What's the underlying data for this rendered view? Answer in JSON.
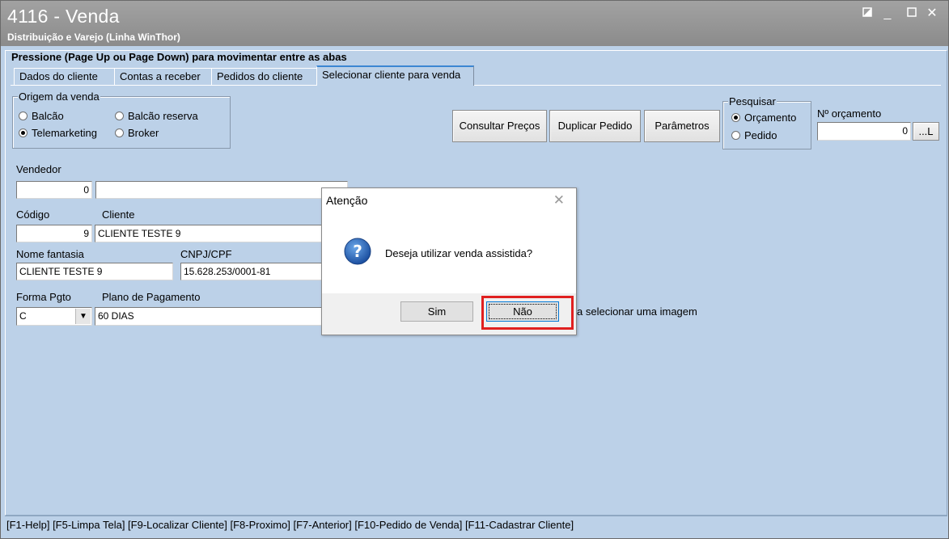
{
  "window": {
    "title": "4116 - Venda",
    "subtitle": "Distribuição e Varejo (Linha WinThor)",
    "controls": [
      "restore-icon",
      "minimize-icon",
      "maximize-icon",
      "close-icon"
    ]
  },
  "tabs_hint": "Pressione (Page Up ou Page Down) para movimentar entre as abas",
  "tabs": [
    {
      "label": "Dados do cliente",
      "active": false
    },
    {
      "label": "Contas a receber",
      "active": false
    },
    {
      "label": "Pedidos do cliente",
      "active": false
    },
    {
      "label": "Selecionar cliente para venda",
      "active": true
    }
  ],
  "origem": {
    "label": "Origem da venda",
    "options": [
      {
        "label": "Balcão",
        "checked": false
      },
      {
        "label": "Balcão reserva",
        "checked": false
      },
      {
        "label": "Telemarketing",
        "checked": true
      },
      {
        "label": "Broker",
        "checked": false
      }
    ]
  },
  "toolbar": {
    "consultar_precos": "Consultar Preços",
    "duplicar_pedido": "Duplicar Pedido",
    "parametros": "Parâmetros"
  },
  "pesquisar": {
    "label": "Pesquisar",
    "options": [
      {
        "label": "Orçamento",
        "checked": true
      },
      {
        "label": "Pedido",
        "checked": false
      }
    ]
  },
  "orcamento": {
    "label": "Nº orçamento",
    "value": "0",
    "lookup_label": "...L"
  },
  "form": {
    "vendedor_label": "Vendedor",
    "vendedor_code": "0",
    "vendedor_name": "",
    "codigo_label": "Código",
    "cliente_label": "Cliente",
    "codigo_value": "9",
    "cliente_value": "CLIENTE TESTE 9",
    "nome_fantasia_label": "Nome fantasia",
    "nome_fantasia_value": "CLIENTE TESTE 9",
    "cnpj_label": "CNPJ/CPF",
    "cnpj_value": "15.628.253/0001-81",
    "forma_pgto_label": "Forma Pgto",
    "forma_pgto_value": "C",
    "plano_label": "Plano de Pagamento",
    "plano_value": "60 DIAS",
    "image_hint": "a selecionar uma imagem"
  },
  "statusbar": "[F1-Help] [F5-Limpa Tela] [F9-Localizar Cliente] [F8-Proximo] [F7-Anterior] [F10-Pedido de Venda] [F11-Cadastrar Cliente]",
  "dialog": {
    "title": "Atenção",
    "message": "Deseja utilizar venda assistida?",
    "yes": "Sim",
    "no": "Não",
    "icon": "question-icon"
  },
  "colors": {
    "window_bg": "#bcd1e8",
    "titlebar": "#949494",
    "highlight": "#e02020",
    "active_tab_accent": "#3c86d2"
  }
}
